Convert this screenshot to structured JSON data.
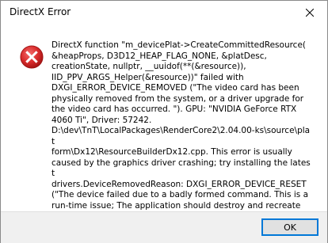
{
  "window": {
    "title": "DirectX Error",
    "close_icon": "close-icon"
  },
  "dialog": {
    "icon": "error-icon",
    "icon_color": "#e81123",
    "message": "DirectX function \"m_devicePlat->CreateCommittedResource(\n&heapProps, D3D12_HEAP_FLAG_NONE, &platDesc,\ncreationState, nullptr, __uuidof(**(&resource)),\nIID_PPV_ARGS_Helper(&resource))\" failed with\nDXGI_ERROR_DEVICE_REMOVED (\"The video card has been\nphysically removed from the system, or a driver upgrade for\nthe video card has occurred. \"). GPU: \"NVIDIA GeForce RTX\n4060 Ti\", Driver: 57242.\nD:\\dev\\TnT\\LocalPackages\\RenderCore2\\2.04.00-ks\\source\\plat\nform\\Dx12\\ResourceBuilderDx12.cpp. This error is usually\ncaused by the graphics driver crashing; try installing the latest\ndrivers.DeviceRemovedReason: DXGI_ERROR_DEVICE_RESET\n(\"The device failed due to a badly formed command. This is a\nrun-time issue; The application should destroy and recreate\nthe device.\").",
    "ok_label": "OK",
    "accent_color": "#0078d7"
  }
}
